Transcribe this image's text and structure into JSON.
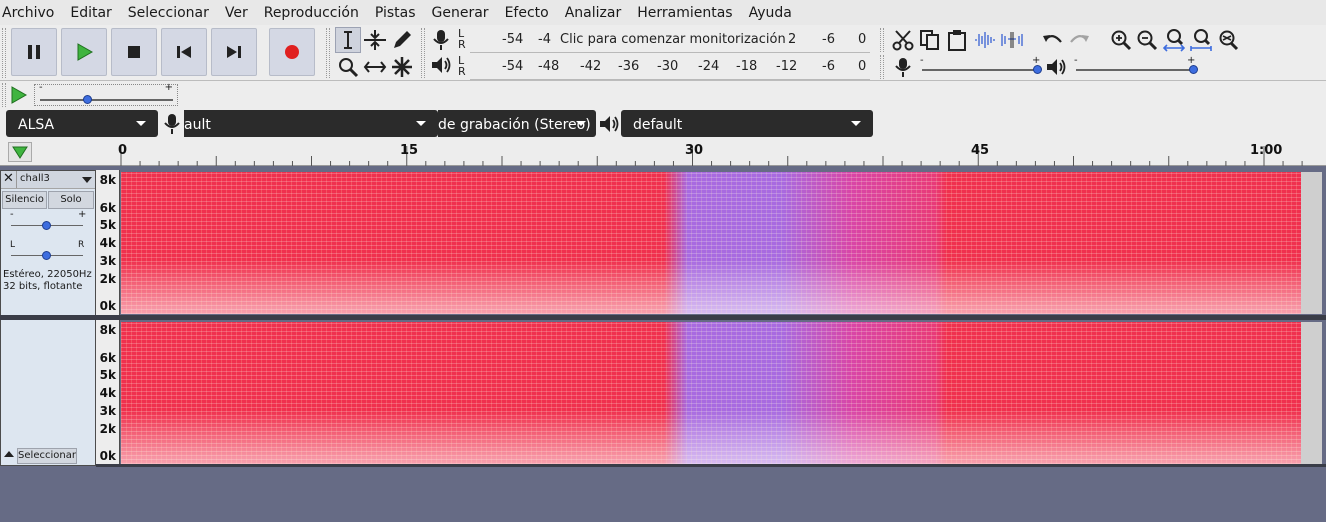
{
  "menubar": {
    "items": [
      "Archivo",
      "Editar",
      "Seleccionar",
      "Ver",
      "Reproducción",
      "Pistas",
      "Generar",
      "Efecto",
      "Analizar",
      "Herramientas",
      "Ayuda"
    ]
  },
  "meters": {
    "record": {
      "channels": "L\nR",
      "ticks": [
        "-54",
        "-4",
        "-6",
        "0"
      ],
      "ticks_right_fragment": "2",
      "message": "Clic para comenzar monitorización"
    },
    "playback": {
      "channels": "L\nR",
      "ticks": [
        "-54",
        "-48",
        "-42",
        "-36",
        "-30",
        "-24",
        "-18",
        "-12",
        "-6",
        "0"
      ]
    }
  },
  "mixer": {
    "record_volume": 1.0,
    "playback_volume": 1.0,
    "minus": "-",
    "plus": "+"
  },
  "play_at_speed": {
    "minus": "-",
    "plus": "+",
    "speed": 0.36
  },
  "devices": {
    "host": "ALSA",
    "record_device": "ault",
    "record_channels": "de grabación (Stereo)",
    "playback_device": "default"
  },
  "ruler": {
    "labels": [
      "0",
      "15",
      "30",
      "45",
      "1:00"
    ]
  },
  "track": {
    "name": "chall3",
    "mute_label": "Silencio",
    "solo_label": "Solo",
    "gain_minus": "-",
    "gain_plus": "+",
    "pan_left": "L",
    "pan_right": "R",
    "gain": 0.5,
    "pan": 0.5,
    "format_line1": "Estéreo, 22050Hz",
    "format_line2": "32 bits, flotante",
    "select_label": "Seleccionar"
  },
  "vertical_scale": {
    "labels": [
      "8k",
      "6k",
      "5k",
      "4k",
      "3k",
      "2k",
      "0k"
    ]
  },
  "colors": {
    "spectrogram_main": "#f0304e",
    "spectrogram_cool": "#a86ae0",
    "accent_knob": "#3d6ddf",
    "record_red": "#e02020",
    "play_green": "#3fb43f"
  },
  "icons": {
    "transport": [
      "pause-icon",
      "play-icon",
      "stop-icon",
      "skip-to-start-icon",
      "skip-to-end-icon",
      "record-icon"
    ],
    "tools": [
      "selection-tool-icon",
      "envelope-tool-icon",
      "draw-tool-icon",
      "zoom-tool-icon",
      "timeshift-tool-icon",
      "multi-tool-icon"
    ],
    "edit": [
      "cut-icon",
      "copy-icon",
      "paste-icon",
      "trim-icon",
      "silence-icon",
      "undo-icon",
      "redo-icon",
      "zoom-in-icon",
      "zoom-out-icon",
      "fit-selection-icon",
      "fit-project-icon",
      "zoom-toggle-icon"
    ]
  }
}
